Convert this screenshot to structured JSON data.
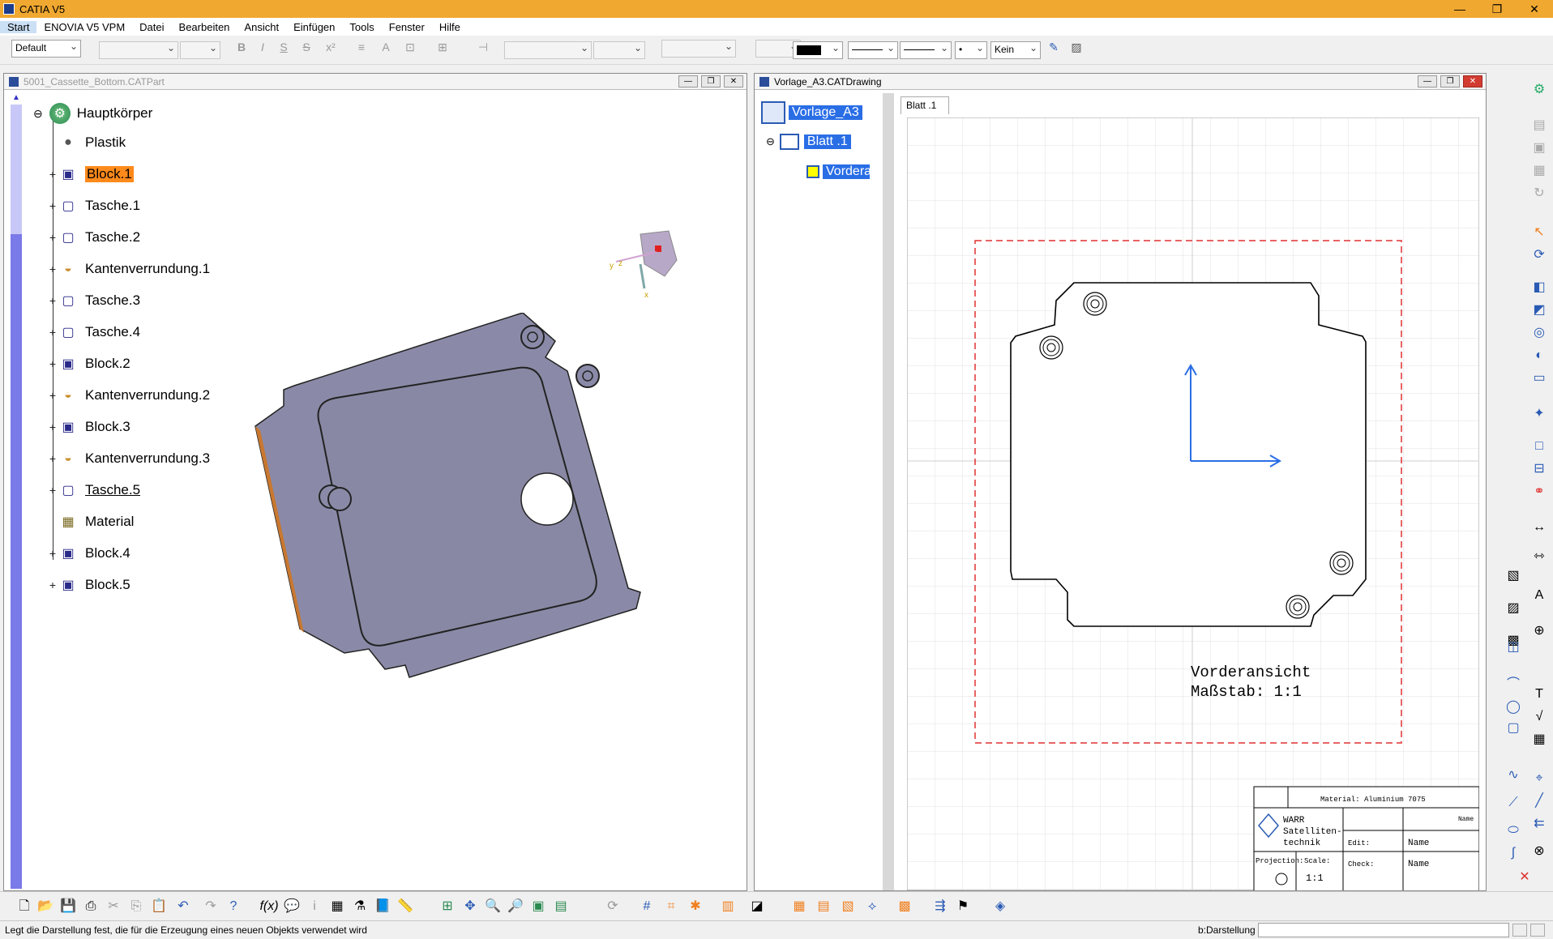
{
  "app": {
    "title": "CATIA V5"
  },
  "menu": [
    "Start",
    "ENOVIA V5 VPM",
    "Datei",
    "Bearbeiten",
    "Ansicht",
    "Einfügen",
    "Tools",
    "Fenster",
    "Hilfe"
  ],
  "toolbar": {
    "style_combo": "Default",
    "linetype_none": "Kein",
    "color_value": "#000000"
  },
  "part_window": {
    "title": "5001_Cassette_Bottom.CATPart",
    "root": "Hauptkörper",
    "items": [
      {
        "label": "Plastik",
        "icon": "sphere-icon",
        "selected": false
      },
      {
        "label": "Block.1",
        "icon": "pad-icon",
        "selected": true
      },
      {
        "label": "Tasche.1",
        "icon": "pocket-icon",
        "selected": false
      },
      {
        "label": "Tasche.2",
        "icon": "pocket-icon",
        "selected": false
      },
      {
        "label": "Kantenverrundung.1",
        "icon": "fillet-icon",
        "selected": false
      },
      {
        "label": "Tasche.3",
        "icon": "pocket-icon",
        "selected": false
      },
      {
        "label": "Tasche.4",
        "icon": "pocket-icon",
        "selected": false
      },
      {
        "label": "Block.2",
        "icon": "pad-icon",
        "selected": false
      },
      {
        "label": "Kantenverrundung.2",
        "icon": "fillet-icon",
        "selected": false
      },
      {
        "label": "Block.3",
        "icon": "pad-icon",
        "selected": false
      },
      {
        "label": "Kantenverrundung.3",
        "icon": "fillet-icon",
        "selected": false
      },
      {
        "label": "Tasche.5",
        "icon": "pocket-icon",
        "selected": false
      },
      {
        "label": "Material",
        "icon": "material-icon",
        "selected": false
      },
      {
        "label": "Block.4",
        "icon": "pad-icon",
        "selected": false
      },
      {
        "label": "Block.5",
        "icon": "pad-icon",
        "selected": false
      }
    ],
    "compass_labels": {
      "x": "x",
      "y": "y",
      "z": "z"
    }
  },
  "drawing_window": {
    "title": "Vorlage_A3.CATDrawing",
    "tree_root": "Vorlage_A3",
    "tree_sheet": "Blatt .1",
    "tree_view": "Vordera",
    "sheet_tab": "Blatt .1",
    "view_caption_line1": "Vorderansicht",
    "view_caption_line2": "Maßstab:  1:1",
    "titleblock": {
      "material": "Material:  Aluminium 7075",
      "company_line1": "WARR",
      "company_line2": "Satelliten-",
      "company_line3": "technik",
      "name_header": "Name",
      "edit_label": "Edit:",
      "edit_value": "Name",
      "check_label": "Check:",
      "check_value": "Name",
      "projection_label": "Projection:",
      "scale_label": "Scale:",
      "scale_value": "1:1"
    }
  },
  "status": {
    "message": "Legt die Darstellung fest, die für die Erzeugung eines neuen Objekts verwendet wird",
    "context": "b:Darstellung"
  }
}
